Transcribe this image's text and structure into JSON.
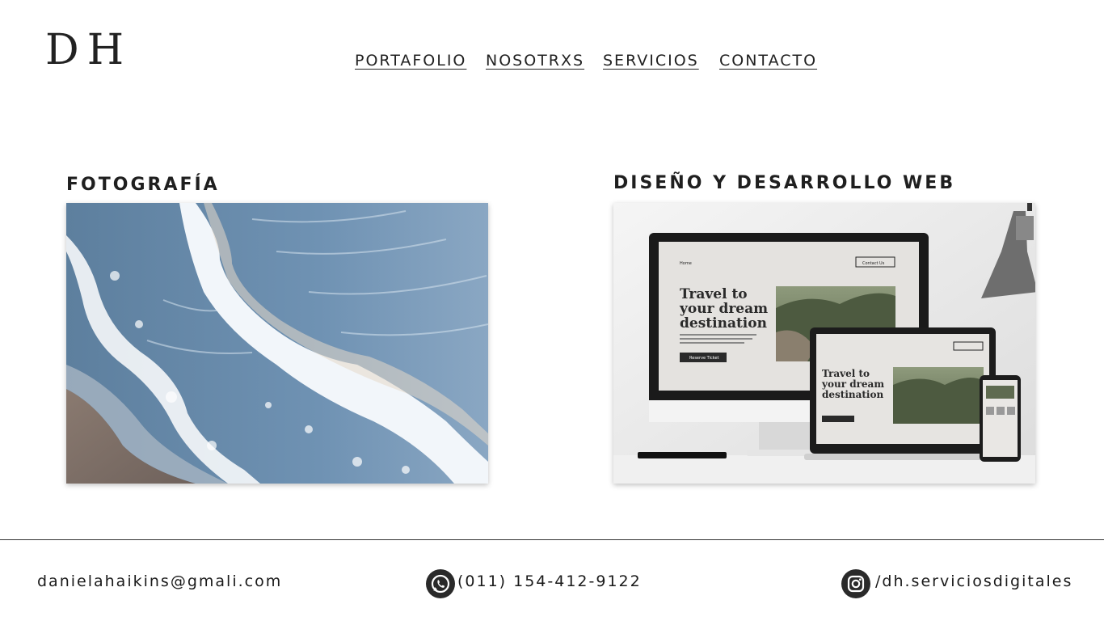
{
  "header": {
    "logo": "DH",
    "nav": [
      "PORTAFOLIO",
      "NOSOTRXS",
      "SERVICIOS",
      "CONTACTO"
    ]
  },
  "sections": {
    "photography": {
      "title": "FOTOGRAFÍA",
      "image": "ocean-waves-photo"
    },
    "web": {
      "title": "DISEÑO Y DESARROLLO WEB",
      "image": "devices-mockup",
      "mockup": {
        "nav_home": "Home",
        "contact_button": "Contact Us",
        "headline_1": "Travel to",
        "headline_2": "your dream",
        "headline_3": "destination",
        "cta": "Reserve Ticket"
      }
    }
  },
  "footer": {
    "email": "danielahaikins@gmali.com",
    "phone": "(011) 154-412-9122",
    "instagram": "/dh.serviciosdigitales",
    "icons": [
      "whatsapp-icon",
      "instagram-icon"
    ]
  },
  "colors": {
    "text": "#1a1a1a",
    "background": "#ffffff",
    "icon_bg": "#2a2a2a"
  }
}
